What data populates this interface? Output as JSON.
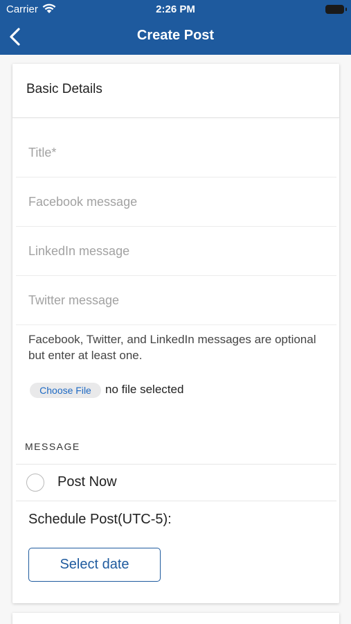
{
  "status_bar": {
    "carrier": "Carrier",
    "time": "2:26 PM"
  },
  "nav": {
    "title": "Create Post",
    "back_icon": "chevron-left-icon"
  },
  "basic_details": {
    "heading": "Basic Details",
    "fields": {
      "title_placeholder": "Title*",
      "facebook_placeholder": "Facebook message",
      "linkedin_placeholder": "LinkedIn message",
      "twitter_placeholder": "Twitter message"
    },
    "hint": "Facebook, Twitter, and LinkedIn messages are optional but enter at least one.",
    "file": {
      "button_label": "Choose File",
      "status": "no file selected"
    }
  },
  "message": {
    "section_label": "MESSAGE",
    "post_now_label": "Post Now",
    "post_now_selected": false,
    "schedule_label": "Schedule Post(UTC-5):",
    "select_date_label": "Select date"
  },
  "colors": {
    "brand": "#1e5a9e",
    "link": "#1e6ac4"
  }
}
